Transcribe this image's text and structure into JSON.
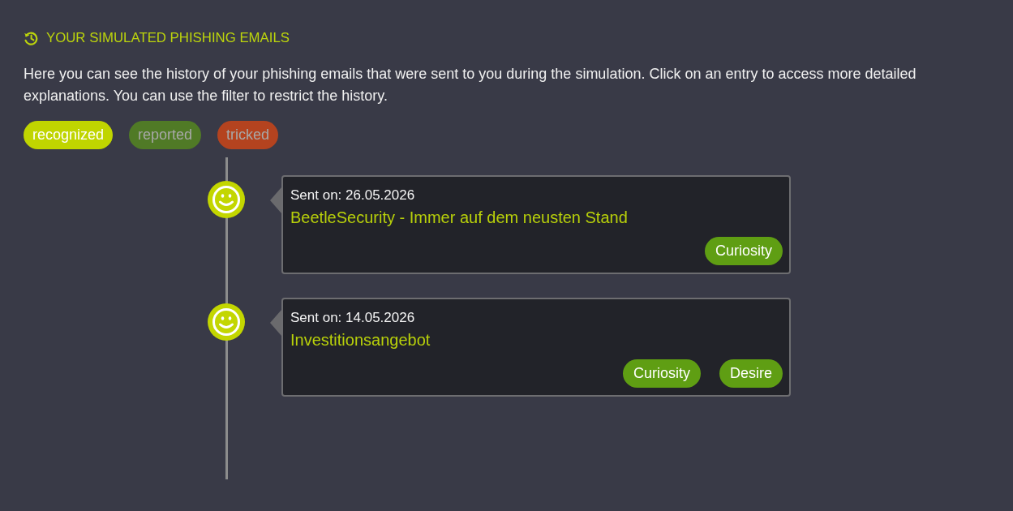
{
  "header": {
    "title": "YOUR SIMULATED PHISHING EMAILS"
  },
  "intro": "Here you can see the history of your phishing emails that were sent to you during the simulation. Click on an entry to access more detailed explanations. You can use the filter to restrict the history.",
  "filters": [
    {
      "label": "recognized",
      "selected": true,
      "color": "#c0d500"
    },
    {
      "label": "reported",
      "selected": false,
      "color": "#507a26"
    },
    {
      "label": "tricked",
      "selected": false,
      "color": "#b4431f"
    }
  ],
  "entries": [
    {
      "kind": "recognized",
      "sent_on": "Sent on: 26.05.2026",
      "subject": "BeetleSecurity - Immer auf dem neusten Stand",
      "tags": [
        "Curiosity"
      ]
    },
    {
      "kind": "recognized",
      "sent_on": "Sent on: 14.05.2026",
      "subject": "Investitionsangebot",
      "tags": [
        "Curiosity",
        "Desire"
      ]
    }
  ]
}
